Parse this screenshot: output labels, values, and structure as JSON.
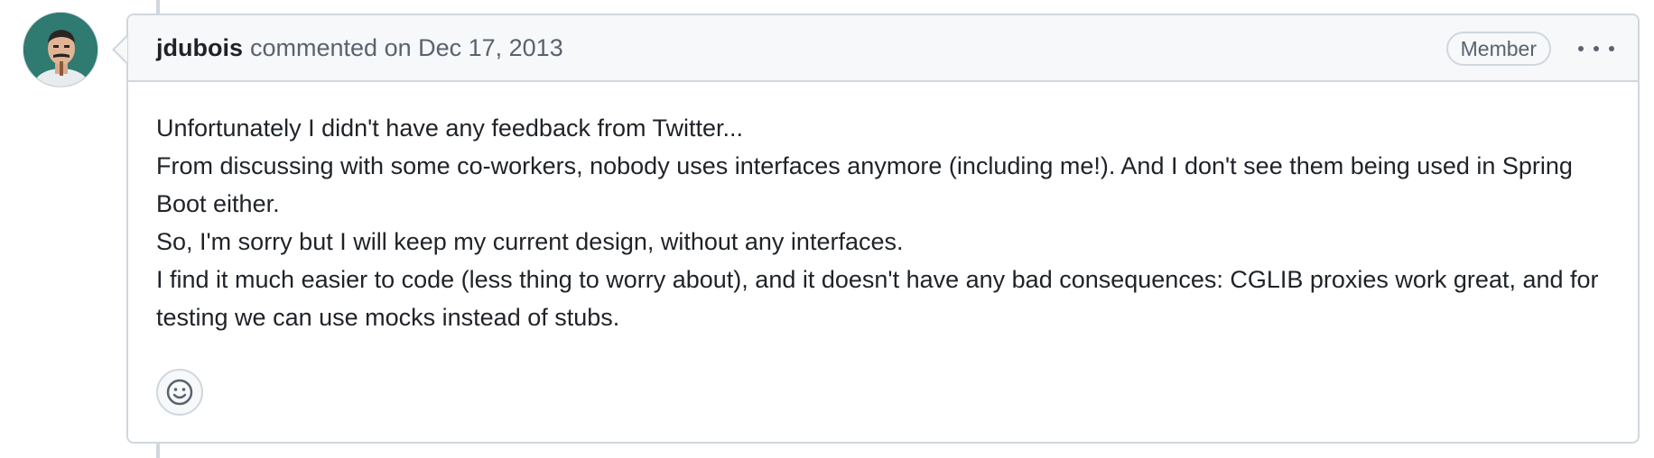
{
  "comment": {
    "author": "jdubois",
    "action_text": "commented on Dec 17, 2013",
    "badge": "Member",
    "menu_icon": "kebab-horizontal-icon",
    "body_lines": [
      "Unfortunately I didn't have any feedback from Twitter...",
      "From discussing with some co-workers, nobody uses interfaces anymore (including me!). And I don't see them being used in Spring Boot either.",
      "So, I'm sorry but I will keep my current design, without any interfaces.",
      "I find it much easier to code (less thing to worry about), and it doesn't have any bad consequences: CGLIB proxies work great, and for testing we can use mocks instead of stubs."
    ],
    "reaction_icon": "smiley-icon"
  },
  "colors": {
    "border": "#d0d7de",
    "header_bg": "#f6f8fa",
    "text": "#1f2328",
    "muted": "#59636e"
  }
}
